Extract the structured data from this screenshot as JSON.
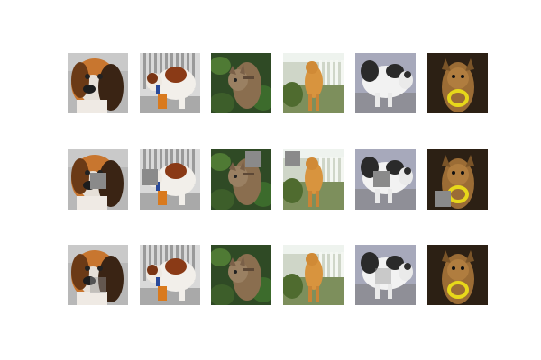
{
  "figure": {
    "rows": [
      {
        "row": "original",
        "tiles": [
          "beagle-dog",
          "white-brown-dog",
          "tabby-cat-in-plants",
          "orange-cat-on-porch",
          "black-white-cat",
          "dog-with-yellow-ring"
        ]
      },
      {
        "row": "occluded",
        "tiles": [
          "beagle-dog",
          "white-brown-dog",
          "tabby-cat-in-plants",
          "orange-cat-on-porch",
          "black-white-cat",
          "dog-with-yellow-ring"
        ]
      },
      {
        "row": "reconstructed",
        "tiles": [
          "beagle-dog",
          "white-brown-dog",
          "tabby-cat-in-plants",
          "orange-cat-on-porch",
          "black-white-cat",
          "dog-with-yellow-ring"
        ]
      }
    ],
    "colors": {
      "background": "#ffffff",
      "occlusion_patch": "#8a8a8a"
    }
  }
}
